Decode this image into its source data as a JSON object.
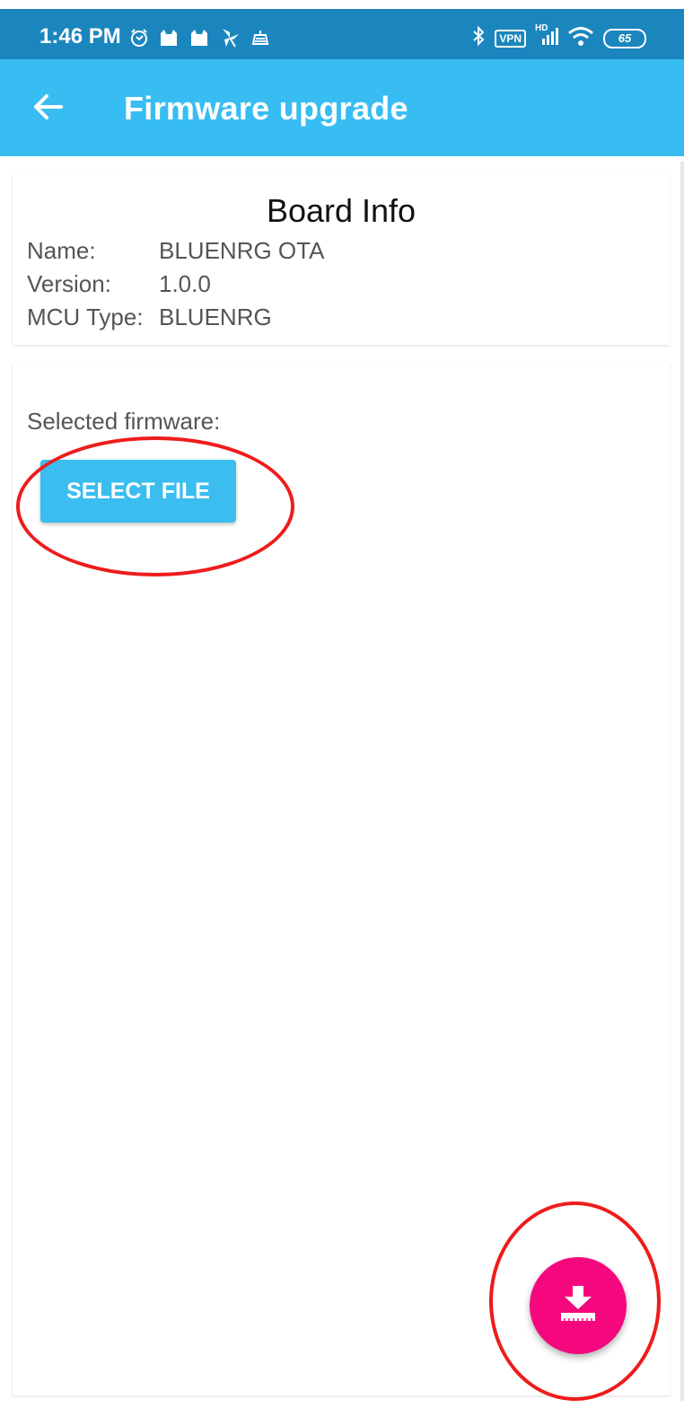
{
  "status_bar": {
    "time": "1:46 PM",
    "left_icons": [
      "alarm-icon",
      "cat-icon",
      "cat-icon",
      "pinwheel-icon",
      "router-icon"
    ],
    "right_icons": [
      "bluetooth-icon",
      "vpn-icon",
      "signal-icon",
      "wifi-icon",
      "battery-icon"
    ],
    "vpn_label": "VPN",
    "signal_label": "HD",
    "battery_level": "65",
    "background_color": "#1b86be"
  },
  "app_bar": {
    "title": "Firmware upgrade",
    "back_icon": "arrow-left-icon",
    "background_color": "#38bdf2"
  },
  "board_info": {
    "title": "Board Info",
    "rows": [
      {
        "label": "Name:",
        "value": "BLUENRG OTA"
      },
      {
        "label": "Version:",
        "value": "1.0.0"
      },
      {
        "label": "MCU Type:",
        "value": "BLUENRG"
      }
    ]
  },
  "firmware": {
    "selected_label": "Selected firmware:",
    "select_button_label": "SELECT FILE",
    "button_color": "#3bbdf0"
  },
  "fab": {
    "icon": "download-firmware-icon",
    "color": "#f5087e"
  },
  "annotations": {
    "ring_color": "#ee1c1c"
  }
}
